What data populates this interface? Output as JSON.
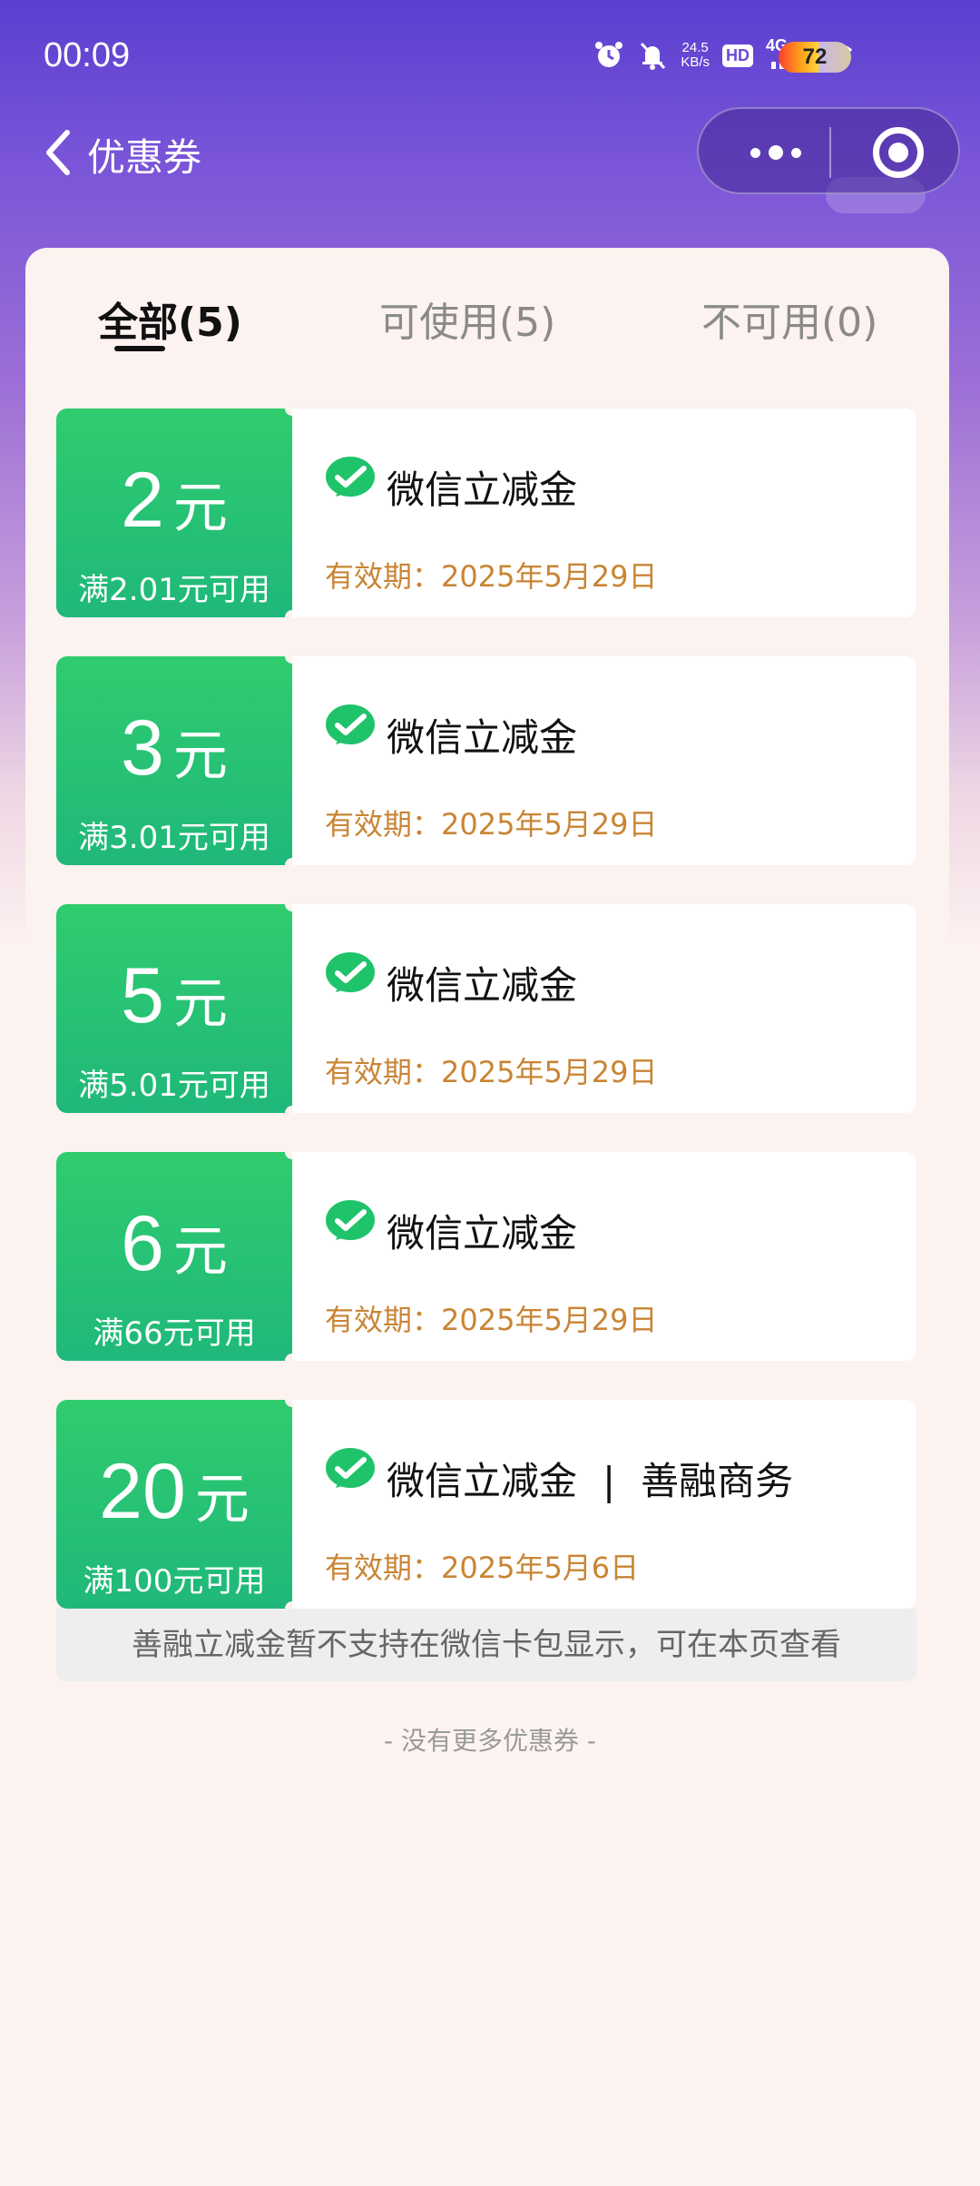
{
  "status_bar": {
    "time": "00:09",
    "net_speed_value": "24.5",
    "net_speed_unit": "KB/s",
    "hd_label": "HD",
    "network_label": "4G",
    "battery": "72",
    "icons": [
      "alarm-icon",
      "mute-icon",
      "signal-icon",
      "wifi-icon",
      "battery-icon"
    ]
  },
  "nav": {
    "title": "优惠券"
  },
  "tabs": [
    {
      "label": "全部(5)",
      "active": true
    },
    {
      "label": "可使用(5)",
      "active": false
    },
    {
      "label": "不可用(0)",
      "active": false
    }
  ],
  "coupons": [
    {
      "amount": "2",
      "unit": "元",
      "condition": "满2.01元可用",
      "title": "微信立减金",
      "merchant": "",
      "validity": "有效期：2025年5月29日"
    },
    {
      "amount": "3",
      "unit": "元",
      "condition": "满3.01元可用",
      "title": "微信立减金",
      "merchant": "",
      "validity": "有效期：2025年5月29日"
    },
    {
      "amount": "5",
      "unit": "元",
      "condition": "满5.01元可用",
      "title": "微信立减金",
      "merchant": "",
      "validity": "有效期：2025年5月29日"
    },
    {
      "amount": "6",
      "unit": "元",
      "condition": "满66元可用",
      "title": "微信立减金",
      "merchant": "",
      "validity": "有效期：2025年5月29日"
    },
    {
      "amount": "20",
      "unit": "元",
      "condition": "满100元可用",
      "title": "微信立减金",
      "separator": "|",
      "merchant": "善融商务",
      "validity": "有效期：2025年5月6日"
    }
  ],
  "notice": "善融立减金暂不支持在微信卡包显示，可在本页查看",
  "footer": "- 没有更多优惠券 -",
  "colors": {
    "coupon_green": "#2fcc6e",
    "validity_orange": "#c98534",
    "header_purple": "#5a3fd0"
  }
}
